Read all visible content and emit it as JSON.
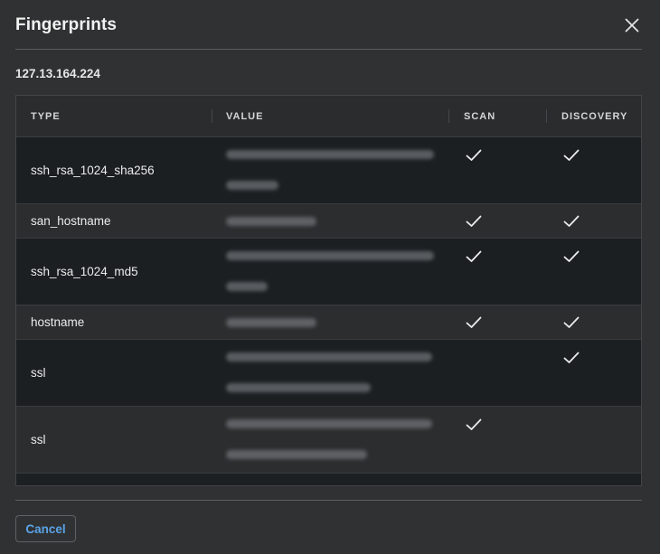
{
  "dialog": {
    "title": "Fingerprints",
    "host": "127.13.164.224",
    "cancel_label": "Cancel"
  },
  "table": {
    "columns": [
      "TYPE",
      "VALUE",
      "SCAN",
      "DISCOVERY"
    ],
    "rows": [
      {
        "type": "ssh_rsa_1024_sha256",
        "value_redacted": true,
        "scan": true,
        "discovery": true
      },
      {
        "type": "san_hostname",
        "value_redacted": true,
        "scan": true,
        "discovery": true
      },
      {
        "type": "ssh_rsa_1024_md5",
        "value_redacted": true,
        "scan": true,
        "discovery": true
      },
      {
        "type": "hostname",
        "value_redacted": true,
        "scan": true,
        "discovery": true
      },
      {
        "type": "ssl",
        "value_redacted": true,
        "scan": false,
        "discovery": true
      },
      {
        "type": "ssl",
        "value_redacted": true,
        "scan": true,
        "discovery": false
      }
    ]
  },
  "icons": {
    "close": "close-icon",
    "check": "checkmark-icon"
  }
}
